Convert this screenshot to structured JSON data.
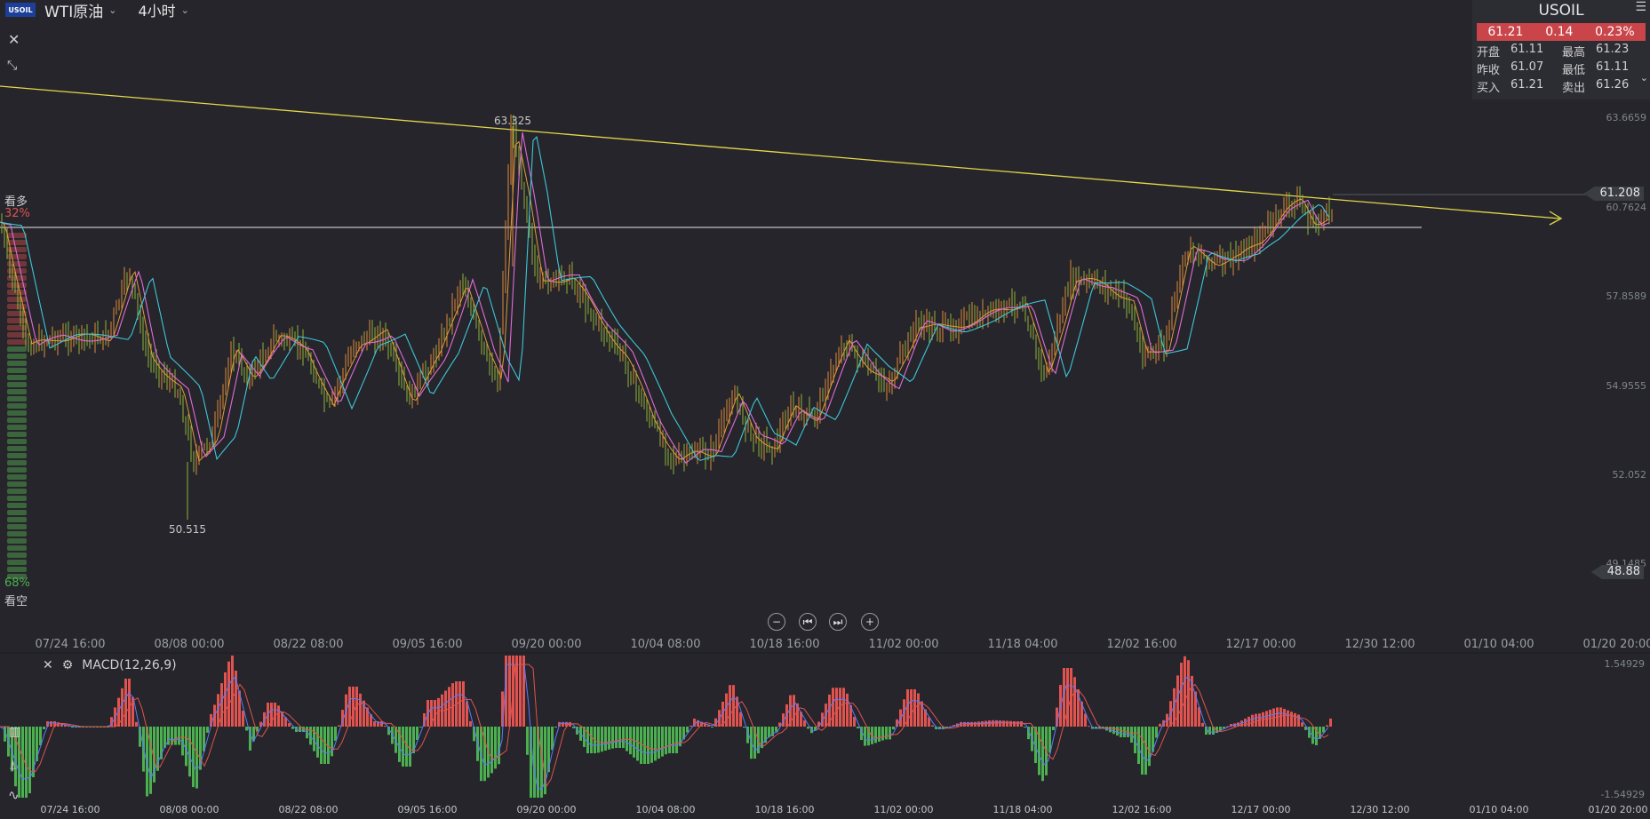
{
  "header": {
    "logo_text": "USOIL",
    "symbol": "WTI原油",
    "timeframe": "4小时"
  },
  "quote": {
    "name": "USOIL",
    "last": "61.21",
    "change": "0.14",
    "change_pct": "0.23%",
    "rows": [
      {
        "k1": "开盘",
        "v1": "61.11",
        "k2": "最高",
        "v2": "61.23"
      },
      {
        "k1": "昨收",
        "v1": "61.07",
        "k2": "最低",
        "v2": "61.11"
      },
      {
        "k1": "买入",
        "v1": "61.21",
        "k2": "卖出",
        "v2": "61.26"
      }
    ]
  },
  "price_axis": {
    "labels": [
      "63.6659",
      "60.7624",
      "57.8589",
      "54.9555",
      "52.052",
      "49.1485"
    ],
    "current_tag": "61.208",
    "low_tag": "48.88"
  },
  "time_axis": {
    "labels": [
      "07/24 16:00",
      "08/08 00:00",
      "08/22 08:00",
      "09/05 16:00",
      "09/20 00:00",
      "10/04 08:00",
      "10/18 16:00",
      "11/02 00:00",
      "11/18 04:00",
      "12/02 16:00",
      "12/17 00:00",
      "12/30 12:00",
      "01/10 04:00",
      "01/20 20:00"
    ]
  },
  "macd_axis": {
    "labels": [
      "07/24 16:00",
      "08/08 00:00",
      "08/22 08:00",
      "09/05 16:00",
      "09/20 00:00",
      "10/04 08:00",
      "10/18 16:00",
      "11/02 00:00",
      "11/18 04:00",
      "12/02 16:00",
      "12/17 00:00",
      "12/30 12:00",
      "01/10 04:00",
      "01/20 20:00"
    ],
    "top": "1.54929",
    "bottom": "-1.54929"
  },
  "annotations": {
    "high": "63.325",
    "low": "50.515"
  },
  "sentiment": {
    "bull_label": "看多",
    "bull_pct": "32%",
    "bear_pct": "68%",
    "bear_label": "看空",
    "bull_color": "#e0534f",
    "bear_color": "#4caf50"
  },
  "indicator": {
    "name": "MACD(12,26,9)"
  },
  "colors": {
    "background": "#25252b",
    "up": "#e0534f",
    "down": "#4caf50",
    "trendline": "#e5d84a",
    "ma_fast": "#e36bd8",
    "ma_slow": "#3ec7d8"
  }
}
